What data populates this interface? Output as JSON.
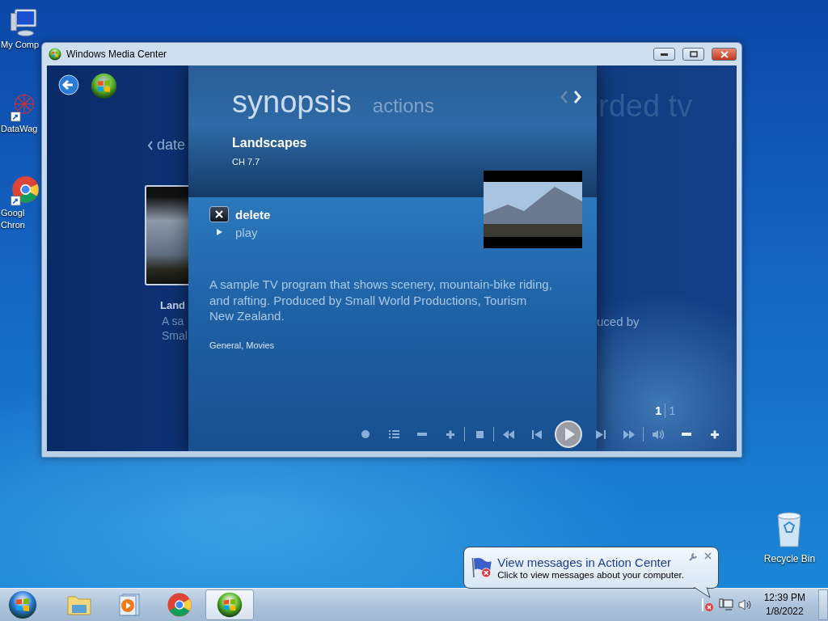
{
  "desktop_icons": [
    {
      "kind": "computer",
      "lines": [
        "My Comp"
      ]
    },
    {
      "kind": "app",
      "lines": [
        "DataWag"
      ]
    },
    {
      "kind": "browser",
      "lines": [
        "Googl",
        "Chron"
      ]
    }
  ],
  "recycle_bin": {
    "label": "Recycle Bin"
  },
  "window": {
    "title": "Windows Media Center"
  },
  "back_page": {
    "nav_label": "date",
    "item_title": "Land",
    "item_lines": [
      "A sa",
      "Smal"
    ],
    "heading": "rded tv",
    "desc_tail": "uced by"
  },
  "synopsis": {
    "tabs": [
      {
        "label": "synopsis",
        "selected": true
      },
      {
        "label": "actions",
        "selected": false
      }
    ],
    "title": "Landscapes",
    "channel": "CH 7.7",
    "actions": [
      {
        "kind": "delete",
        "label": "delete",
        "selected": true
      },
      {
        "kind": "play",
        "label": "play",
        "selected": false
      }
    ],
    "description": "A sample TV program that shows scenery, mountain-bike riding, and rafting. Produced by Small World Productions, Tourism New Zealand.",
    "genres": "General, Movies"
  },
  "page_counter": {
    "current": "1",
    "total": "1"
  },
  "notification": {
    "title": "View messages in Action Center",
    "message": "Click to view messages about your computer."
  },
  "taskbar": {
    "items": [
      {
        "kind": "explorer",
        "selected": false
      },
      {
        "kind": "media-player",
        "selected": false
      },
      {
        "kind": "browser",
        "selected": false
      },
      {
        "kind": "media-center",
        "selected": true
      }
    ]
  },
  "clock": {
    "time": "12:39 PM",
    "date": "1/8/2022"
  }
}
